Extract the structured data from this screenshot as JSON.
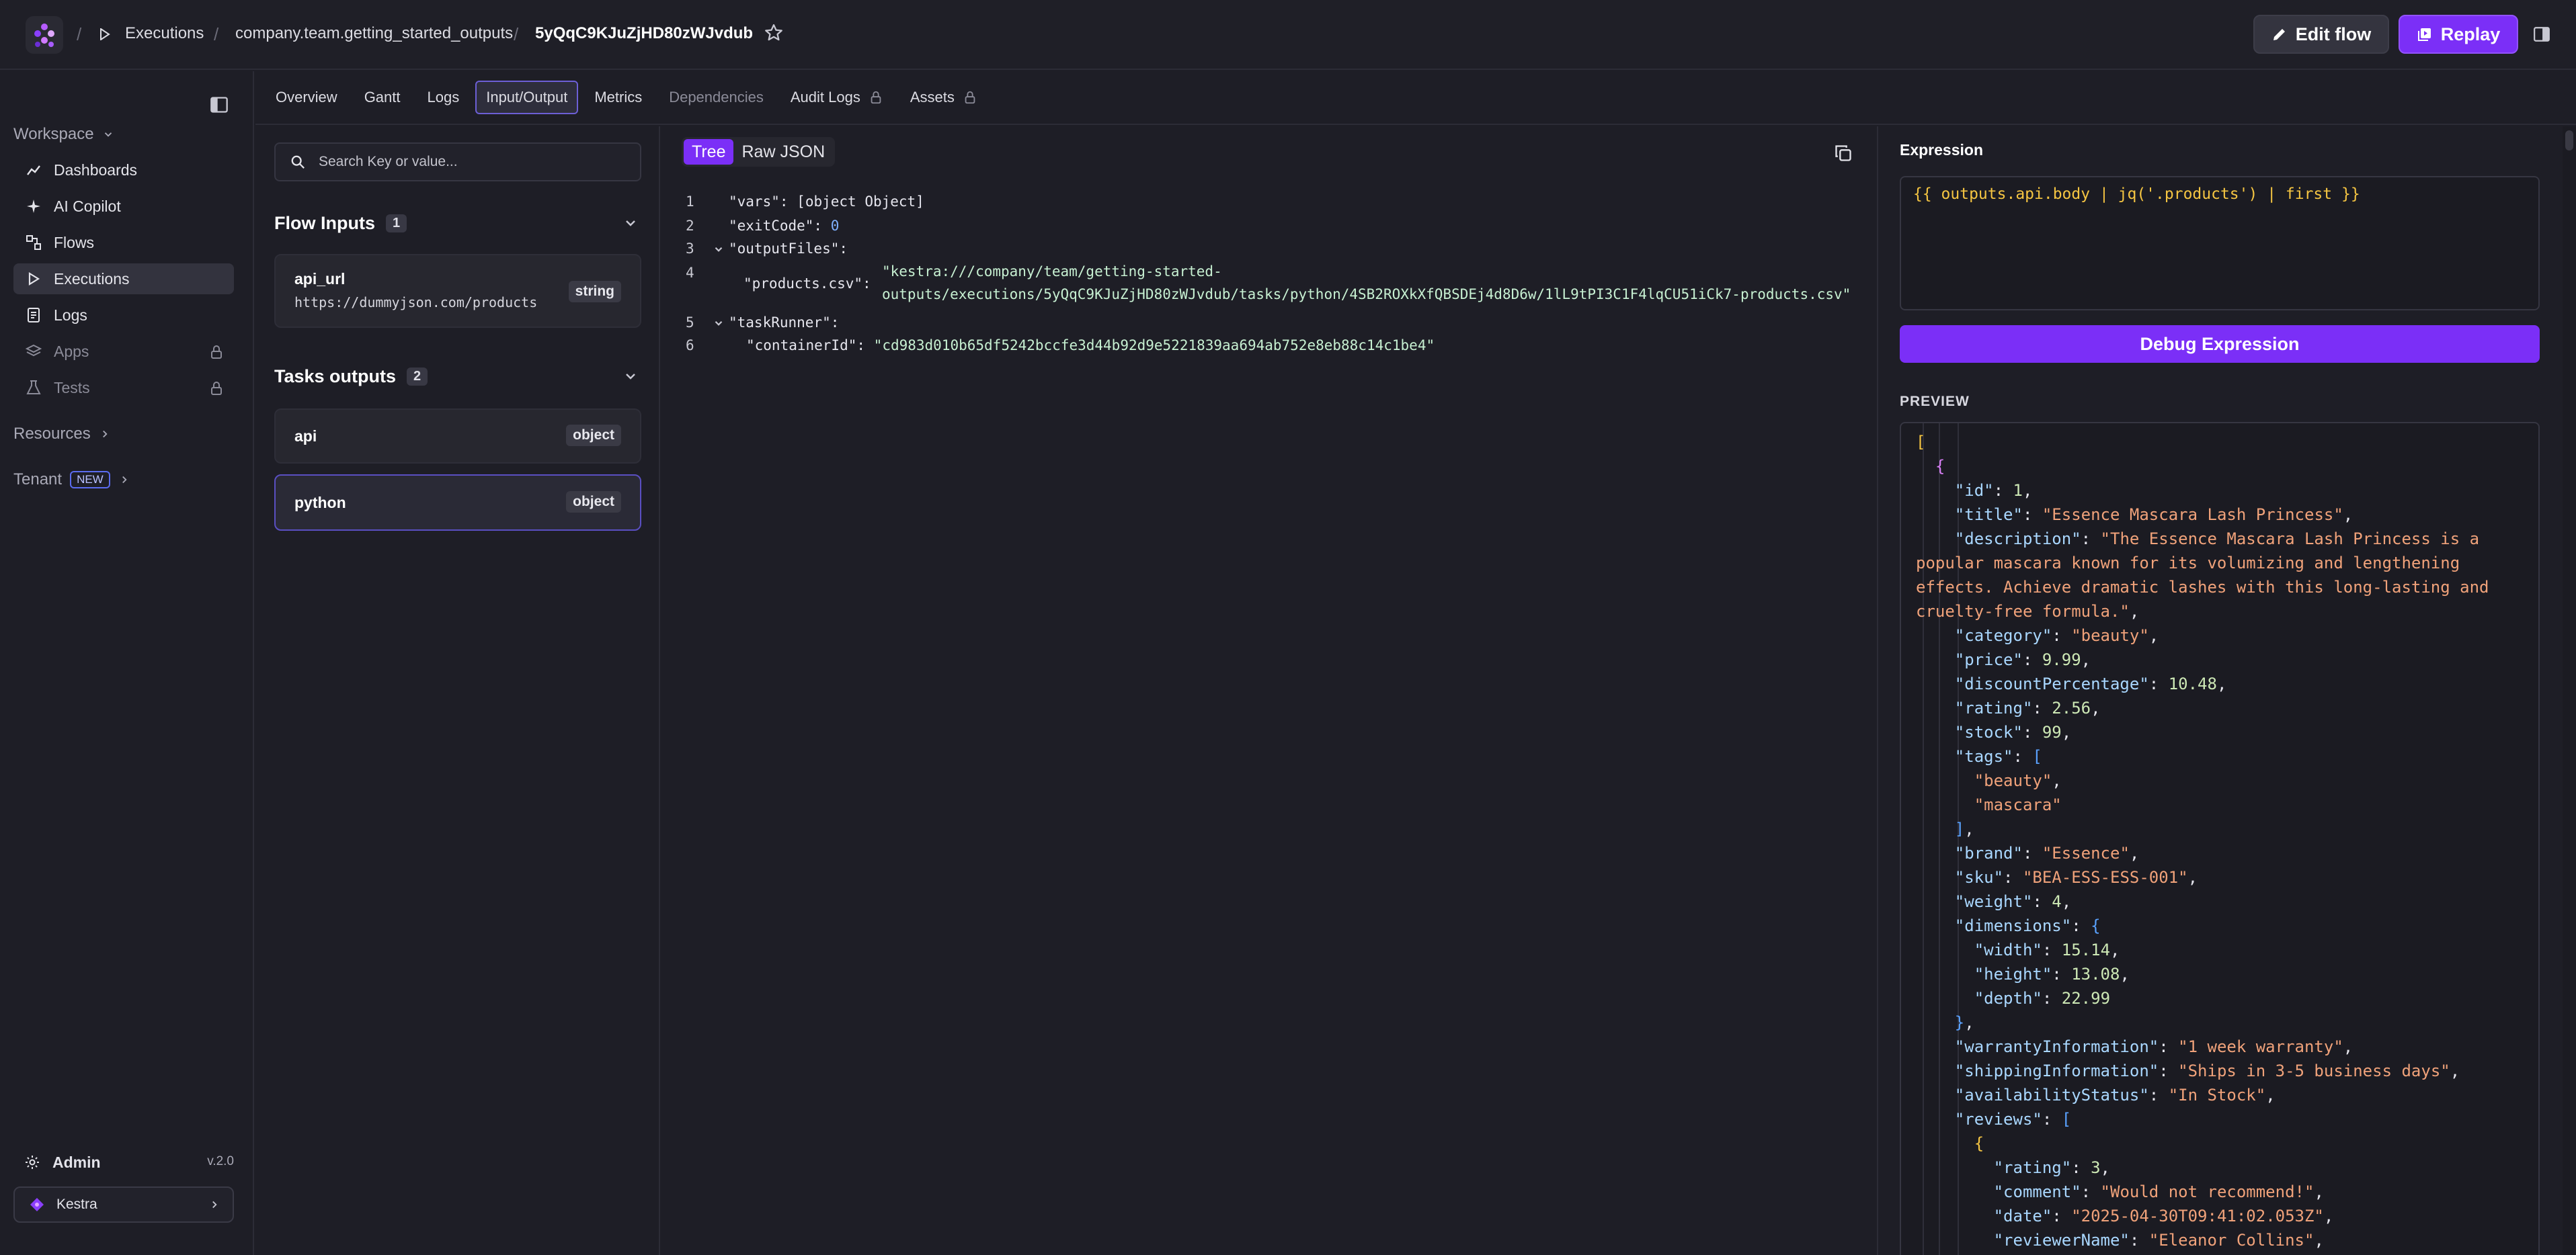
{
  "breadcrumb": {
    "section": "Executions",
    "namespace_flow": "company.team.getting_started_outputs",
    "execution_id": "5yQqC9KJuZjHD80zWJvdub"
  },
  "header": {
    "edit_flow_label": "Edit flow",
    "replay_label": "Replay"
  },
  "sidebar": {
    "workspace_label": "Workspace",
    "items": [
      {
        "label": "Dashboards",
        "icon": "chart-line-icon"
      },
      {
        "label": "AI Copilot",
        "icon": "sparkle-icon"
      },
      {
        "label": "Flows",
        "icon": "flows-icon"
      },
      {
        "label": "Executions",
        "icon": "play-icon"
      },
      {
        "label": "Logs",
        "icon": "document-icon"
      },
      {
        "label": "Apps",
        "icon": "layers-icon"
      },
      {
        "label": "Tests",
        "icon": "flask-icon"
      }
    ],
    "resources_label": "Resources",
    "tenant_label": "Tenant",
    "new_badge": "NEW",
    "admin_label": "Admin",
    "version": "v.2.0",
    "tenant_name": "Kestra"
  },
  "tabs": [
    "Overview",
    "Gantt",
    "Logs",
    "Input/Output",
    "Metrics",
    "Dependencies",
    "Audit Logs",
    "Assets"
  ],
  "io": {
    "search_placeholder": "Search Key or value...",
    "flow_inputs_title": "Flow Inputs",
    "flow_inputs_count": "1",
    "inputs": [
      {
        "name": "api_url",
        "value": "https://dummyjson.com/products",
        "type": "string"
      }
    ],
    "tasks_outputs_title": "Tasks outputs",
    "tasks_outputs_count": "2",
    "outputs": [
      {
        "name": "api",
        "type": "object"
      },
      {
        "name": "python",
        "type": "object"
      }
    ]
  },
  "viewer": {
    "tree_label": "Tree",
    "raw_label": "Raw JSON",
    "lines": [
      {
        "n": "1",
        "key": "\"vars\":",
        "value": "[object Object]"
      },
      {
        "n": "2",
        "key": "\"exitCode\":",
        "value": "0"
      },
      {
        "n": "3",
        "key": "\"outputFiles\":",
        "value": ""
      },
      {
        "n": "4",
        "key": "\"products.csv\":",
        "value": "\"kestra:///company/team/getting-started-",
        "value2": "outputs/executions/5yQqC9KJuZjHD80zWJvdub/tasks/python/4SB2ROXkXfQBSDEj4d8D6w/1lL9tPI3C1F4lqCU51iCk7-products.csv\""
      },
      {
        "n": "5",
        "key": "\"taskRunner\":",
        "value": ""
      },
      {
        "n": "6",
        "key": "\"containerId\":",
        "value": "\"cd983d010b65df5242bccfe3d44b92d9e5221839aa694ab752e8eb88c14c1be4\""
      }
    ]
  },
  "expression": {
    "label": "Expression",
    "value": "{{ outputs.api.body | jq('.products') | first }}",
    "debug_label": "Debug Expression",
    "preview_label": "PREVIEW"
  },
  "preview": {
    "id": "1",
    "title": "\"Essence Mascara Lash Princess\"",
    "description": "\"The Essence Mascara Lash Princess is a popular mascara known for its volumizing and lengthening effects. Achieve dramatic lashes with this long-lasting and cruelty-free formula.\"",
    "category": "\"beauty\"",
    "price": "9.99",
    "discountPercentage": "10.48",
    "rating": "2.56",
    "stock": "99",
    "tag1": "\"beauty\"",
    "tag2": "\"mascara\"",
    "brand": "\"Essence\"",
    "sku": "\"BEA-ESS-ESS-001\"",
    "weight": "4",
    "width": "15.14",
    "height": "13.08",
    "depth": "22.99",
    "warrantyInformation": "\"1 week warranty\"",
    "shippingInformation": "\"Ships in 3-5 business days\"",
    "availabilityStatus": "\"In Stock\"",
    "review_rating": "3",
    "review_comment": "\"Would not recommend!\"",
    "review_date": "\"2025-04-30T09:41:02.053Z\"",
    "review_reviewerName": "\"Eleanor Collins\""
  }
}
